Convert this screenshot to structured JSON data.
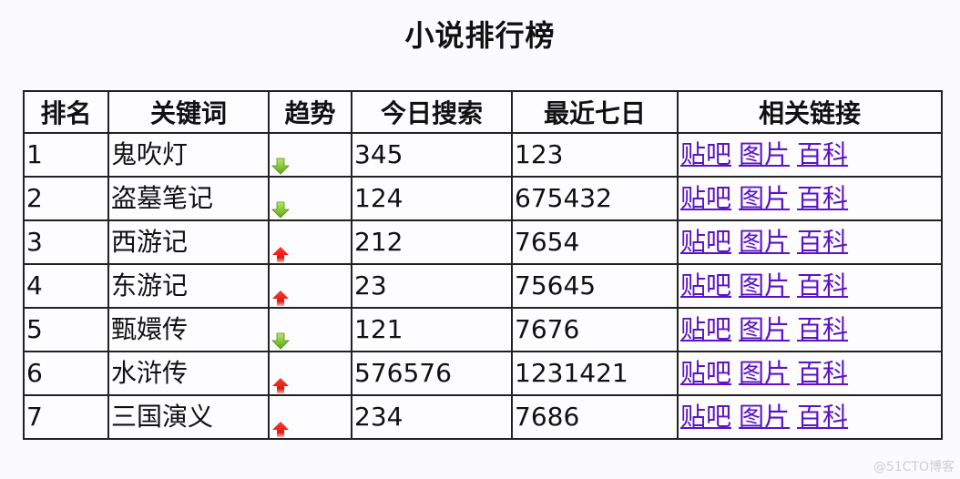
{
  "page": {
    "title": "小说排行榜",
    "watermark": "@51CTO博客"
  },
  "table": {
    "headers": [
      "排名",
      "关键词",
      "趋势",
      "今日搜索",
      "最近七日",
      "相关链接"
    ],
    "rows": [
      {
        "rank": "1",
        "keyword": "鬼吹灯",
        "trend": "down",
        "today": "345",
        "week": "123",
        "links": [
          "贴吧",
          "图片",
          "百科"
        ]
      },
      {
        "rank": "2",
        "keyword": "盗墓笔记",
        "trend": "down",
        "today": "124",
        "week": "675432",
        "links": [
          "贴吧",
          "图片",
          "百科"
        ]
      },
      {
        "rank": "3",
        "keyword": "西游记",
        "trend": "up",
        "today": "212",
        "week": "7654",
        "links": [
          "贴吧",
          "图片",
          "百科"
        ]
      },
      {
        "rank": "4",
        "keyword": "东游记",
        "trend": "up",
        "today": "23",
        "week": "75645",
        "links": [
          "贴吧",
          "图片",
          "百科"
        ]
      },
      {
        "rank": "5",
        "keyword": "甄嬛传",
        "trend": "down",
        "today": "121",
        "week": "7676",
        "links": [
          "贴吧",
          "图片",
          "百科"
        ]
      },
      {
        "rank": "6",
        "keyword": "水浒传",
        "trend": "up",
        "today": "576576",
        "week": "1231421",
        "links": [
          "贴吧",
          "图片",
          "百科"
        ]
      },
      {
        "rank": "7",
        "keyword": "三国演义",
        "trend": "up",
        "today": "234",
        "week": "7686",
        "links": [
          "贴吧",
          "图片",
          "百科"
        ]
      }
    ]
  },
  "colors": {
    "link": "#5a13c9",
    "trend_up": "#e8201c",
    "trend_down": "#7cc21e",
    "border": "#222222"
  },
  "icons": {
    "up": "arrow-up-icon",
    "down": "arrow-down-icon"
  }
}
